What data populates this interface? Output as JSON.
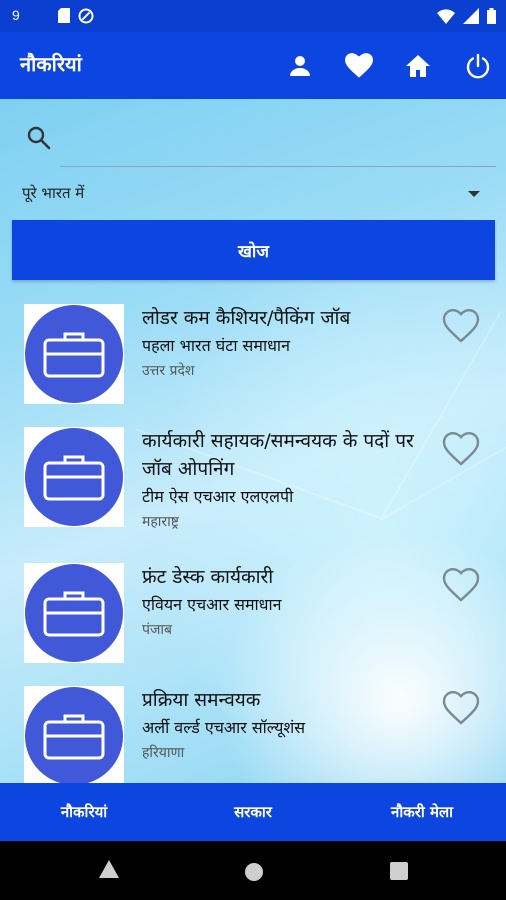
{
  "status_bar": {
    "time": "9",
    "icons": [
      "sd-card-icon",
      "do-not-disturb-icon",
      "wifi-icon",
      "cellular-icon",
      "battery-icon"
    ]
  },
  "app_bar": {
    "title": "नौकरियां",
    "actions": [
      "profile-icon",
      "favorites-heart-icon",
      "home-icon",
      "power-icon"
    ]
  },
  "search": {
    "placeholder": "",
    "value": "",
    "location": "पूरे भारत में",
    "button_label": "खोज"
  },
  "jobs": [
    {
      "title": "लोडर कम कैशियर/पैकिंग जॉब",
      "company": "पहला भारत घंटा समाधान",
      "location": "उत्तर प्रदेश"
    },
    {
      "title": "कार्यकारी सहायक/समन्वयक के पदों पर जॉब ओपनिंग",
      "company": "टीम ऐस एचआर एलएलपी",
      "location": "महाराष्ट्र"
    },
    {
      "title": "फ्रंट डेस्क कार्यकारी",
      "company": "एवियन एचआर समाधान",
      "location": "पंजाब"
    },
    {
      "title": "प्रक्रिया समन्वयक",
      "company": "अर्ली वर्ल्ड एचआर सॉल्यूशंस",
      "location": "हरियाणा"
    }
  ],
  "bottom_nav": {
    "tabs": [
      "नौकरियां",
      "सरकार",
      "नौकरी मेला"
    ]
  },
  "colors": {
    "primary": "#0d45e0",
    "status_bar": "#0a3fcf",
    "job_icon": "#4158d8"
  }
}
